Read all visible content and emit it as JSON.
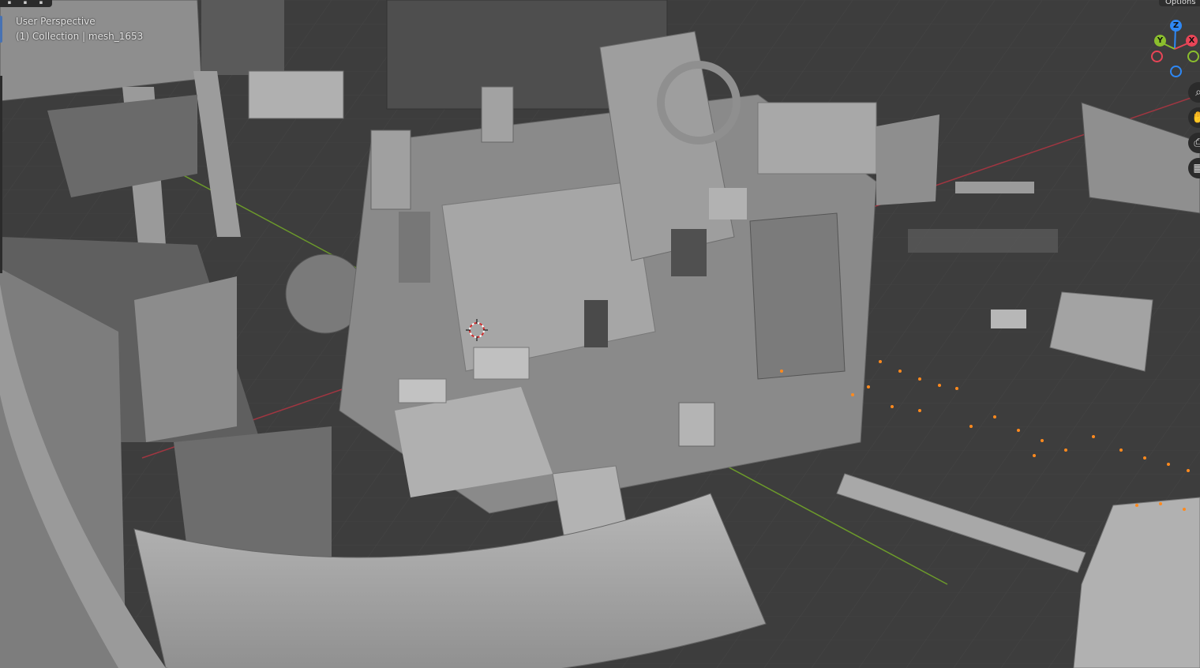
{
  "viewport": {
    "mode_label": "User Perspective",
    "collection_label": "(1) Collection | mesh_1653",
    "options_label": "Options",
    "colors": {
      "background": "#3d3d3d",
      "grid": "#484848",
      "x_axis": "#b03a44",
      "y_axis": "#6c9a2b",
      "mesh": "#a9a9a9",
      "selection": "#ff8a1e"
    }
  },
  "gizmo": {
    "z_label": "Z",
    "y_label": "Y",
    "x_label": "X",
    "colors": {
      "x": "#e84557",
      "y": "#8bbf2d",
      "z": "#2e88f5"
    }
  },
  "nav_tools": [
    {
      "icon": "zoom-icon"
    },
    {
      "icon": "hand-pan-icon"
    },
    {
      "icon": "camera-icon"
    },
    {
      "icon": "grid-perspective-icon"
    }
  ]
}
